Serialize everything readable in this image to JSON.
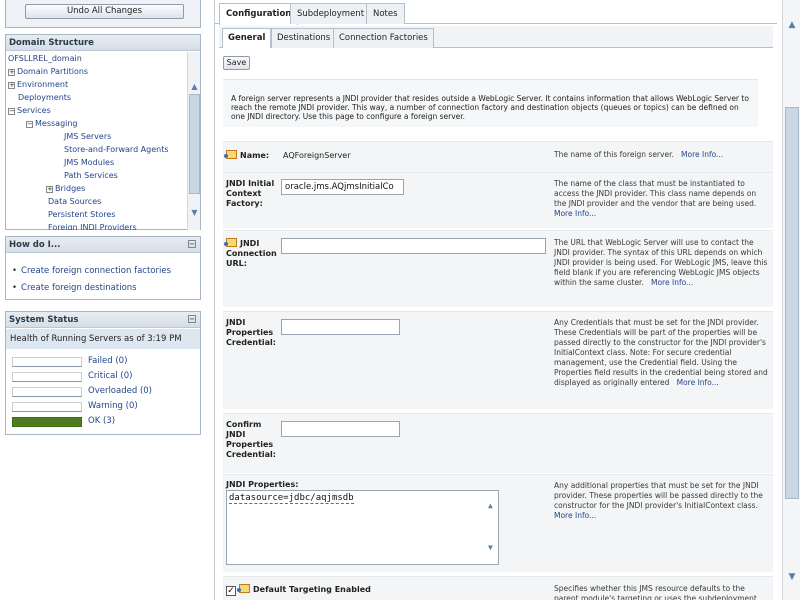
{
  "left": {
    "undo_label": "Undo All Changes",
    "domain_structure": {
      "title": "Domain Structure",
      "items": [
        {
          "label": "OFSLLREL_domain",
          "toggle": ""
        },
        {
          "label": "Domain Partitions",
          "toggle": "+"
        },
        {
          "label": "Environment",
          "toggle": "+"
        },
        {
          "label": "Deployments",
          "toggle": ""
        },
        {
          "label": "Services",
          "toggle": "−"
        },
        {
          "label": "Messaging",
          "toggle": "−"
        },
        {
          "label": "JMS Servers",
          "toggle": ""
        },
        {
          "label": "Store-and-Forward Agents",
          "toggle": ""
        },
        {
          "label": "JMS Modules",
          "toggle": ""
        },
        {
          "label": "Path Services",
          "toggle": ""
        },
        {
          "label": "Bridges",
          "toggle": "+"
        },
        {
          "label": "Data Sources",
          "toggle": ""
        },
        {
          "label": "Persistent Stores",
          "toggle": ""
        },
        {
          "label": "Foreign JNDI Providers",
          "toggle": ""
        }
      ]
    },
    "how_do_i": {
      "title": "How do I...",
      "links": [
        "Create foreign connection factories",
        "Create foreign destinations"
      ]
    },
    "system_status": {
      "title": "System Status",
      "health_text": "Health of Running Servers as of  3:19 PM",
      "rows": [
        {
          "label": "Failed (0)",
          "fill": 0
        },
        {
          "label": "Critical (0)",
          "fill": 0
        },
        {
          "label": "Overloaded (0)",
          "fill": 0
        },
        {
          "label": "Warning (0)",
          "fill": 0
        },
        {
          "label": "OK (3)",
          "fill": 1
        }
      ]
    }
  },
  "main": {
    "tabs": [
      "Configuration",
      "Subdeployment",
      "Notes"
    ],
    "subtabs": [
      "General",
      "Destinations",
      "Connection Factories"
    ],
    "save_label": "Save",
    "intro": "A foreign server represents a JNDI provider that resides outside a WebLogic Server. It contains information that allows WebLogic Server to reach the remote JNDI provider. This way, a number of connection factory and destination objects (queues or topics) can be defined on one JNDI directory. Use this page to configure a foreign server.",
    "more_info": "More Info...",
    "fields": {
      "name": {
        "label": "Name:",
        "value": "AQForeignServer",
        "help": "The name of this foreign server."
      },
      "initial_context": {
        "label": "JNDI Initial Context Factory:",
        "value": "oracle.jms.AQjmsInitialCo",
        "help": "The name of the class that must be instantiated to access the JNDI provider. This class name depends on the JNDI provider and the vendor that are being used."
      },
      "connection_url": {
        "label": "JNDI Connection URL:",
        "value": "",
        "help": "The URL that WebLogic Server will use to contact the JNDI provider. The syntax of this URL depends on which JNDI provider is being used. For WebLogic JMS, leave this field blank if you are referencing WebLogic JMS objects within the same cluster."
      },
      "credential": {
        "label": "JNDI Properties Credential:",
        "value": "",
        "help": "Any Credentials that must be set for the JNDI provider. These Credentials will be part of the properties will be passed directly to the constructor for the JNDI provider's InitialContext class. Note: For secure credential management, use the Credential field. Using the Properties field results in the credential being stored and displayed as originally entered"
      },
      "confirm_credential": {
        "label": "Confirm JNDI Properties Credential:",
        "value": ""
      },
      "properties": {
        "label": "JNDI Properties:",
        "value": "datasource=jdbc/aqjmsdb",
        "help": "Any additional properties that must be set for the JNDI provider. These properties will be passed directly to the constructor for the JNDI provider's InitialContext class."
      },
      "default_targeting": {
        "label": "Default Targeting Enabled",
        "checked": true,
        "help": "Specifies whether this JMS resource defaults to the parent module's targeting or uses the subdeployment"
      }
    }
  }
}
